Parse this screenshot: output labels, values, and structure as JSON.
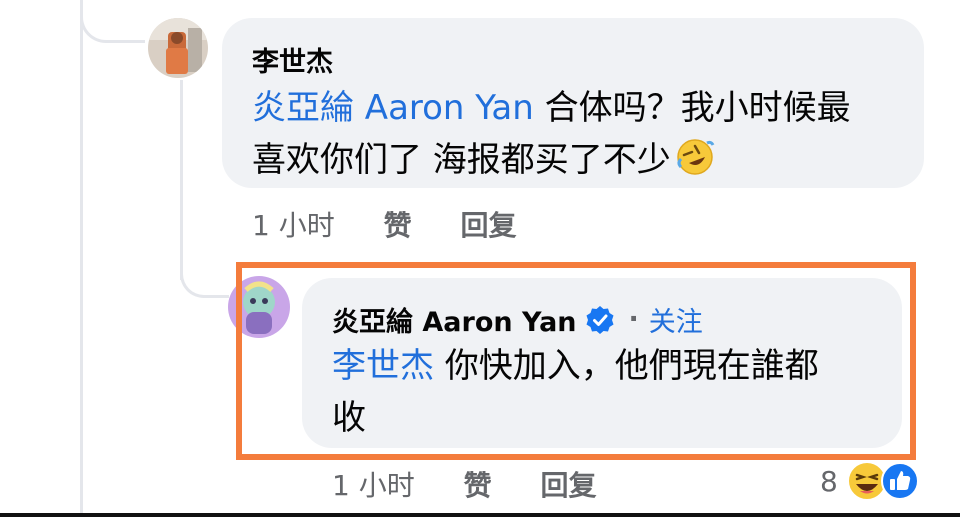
{
  "comment1": {
    "author": "李世杰",
    "mention": "炎亞綸 Aaron Yan",
    "text_line1": " 合体吗？我小时候最",
    "text_line2": "喜欢你们了 海报都买了不少",
    "emoji": "rolling-on-floor-laughing",
    "time": "1 小时",
    "like": "赞",
    "reply": "回复"
  },
  "comment2": {
    "author": "炎亞綸 Aaron Yan",
    "verified": true,
    "separator": "·",
    "follow": "关注",
    "mention": "李世杰",
    "text_line1": " 你快加入，他們現在誰都",
    "text_line2": "收",
    "time": "1 小时",
    "like": "赞",
    "reply": "回复",
    "reaction_count": "8",
    "reactions": [
      "haha",
      "like"
    ]
  },
  "colors": {
    "highlight_border": "#f47c3c",
    "mention_blue": "#216fdb",
    "bubble_bg": "#f0f2f5",
    "meta_gray": "#65676b"
  }
}
